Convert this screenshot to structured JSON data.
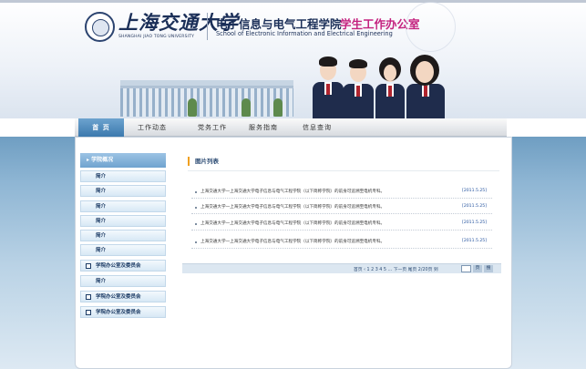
{
  "header": {
    "university_cn": "上海交通大学",
    "university_en": "SHANGHAI JIAO TONG UNIVERSITY",
    "school_cn": "电子信息与电气工程学院",
    "office_cn": "学生工作办公室",
    "school_en": "School of Electronic Information and Electrical Engineering"
  },
  "nav": {
    "items": [
      {
        "label": "首 页"
      },
      {
        "label": "工作动态"
      },
      {
        "label": "党务工作"
      },
      {
        "label": "服务指南"
      },
      {
        "label": "信息查询"
      }
    ]
  },
  "sidebar": {
    "heading": "▸ 学院概况",
    "items": [
      {
        "label": "简介",
        "icon": null
      },
      {
        "label": "简介",
        "icon": null
      },
      {
        "label": "简介",
        "icon": null
      },
      {
        "label": "简介",
        "icon": null
      },
      {
        "label": "简介",
        "icon": null
      },
      {
        "label": "简介",
        "icon": null
      },
      {
        "label": "学院办公室及委员会",
        "icon": "doc-icon"
      },
      {
        "label": "简介",
        "icon": null
      },
      {
        "label": "学院办公室及委员会",
        "icon": "doc-icon"
      },
      {
        "label": "学院办公室及委员会",
        "icon": "doc-icon"
      }
    ]
  },
  "list": {
    "title": "图片列表",
    "rows": [
      {
        "title": "上海交通大学一上海交通大学电子信息与电气工程学院（以下简称学院）的前身可追溯至电机专科。",
        "date": "[2011.5.25]"
      },
      {
        "title": "上海交通大学一上海交通大学电子信息与电气工程学院（以下简称学院）的前身可追溯至电机专科。",
        "date": "[2011.5.25]"
      },
      {
        "title": "上海交通大学一上海交通大学电子信息与电气工程学院（以下简称学院）的前身可追溯至电机专科。",
        "date": "[2011.5.25]"
      },
      {
        "title": "上海交通大学一上海交通大学电子信息与电气工程学院（以下简称学院）的前身可追溯至电机专科。",
        "date": "[2011.5.25]"
      }
    ]
  },
  "pager": {
    "text": "首页  ‹ 1 2 3 4 5 … 下一页  尾页  2/20页  到",
    "go": "页",
    "search": "搜"
  }
}
